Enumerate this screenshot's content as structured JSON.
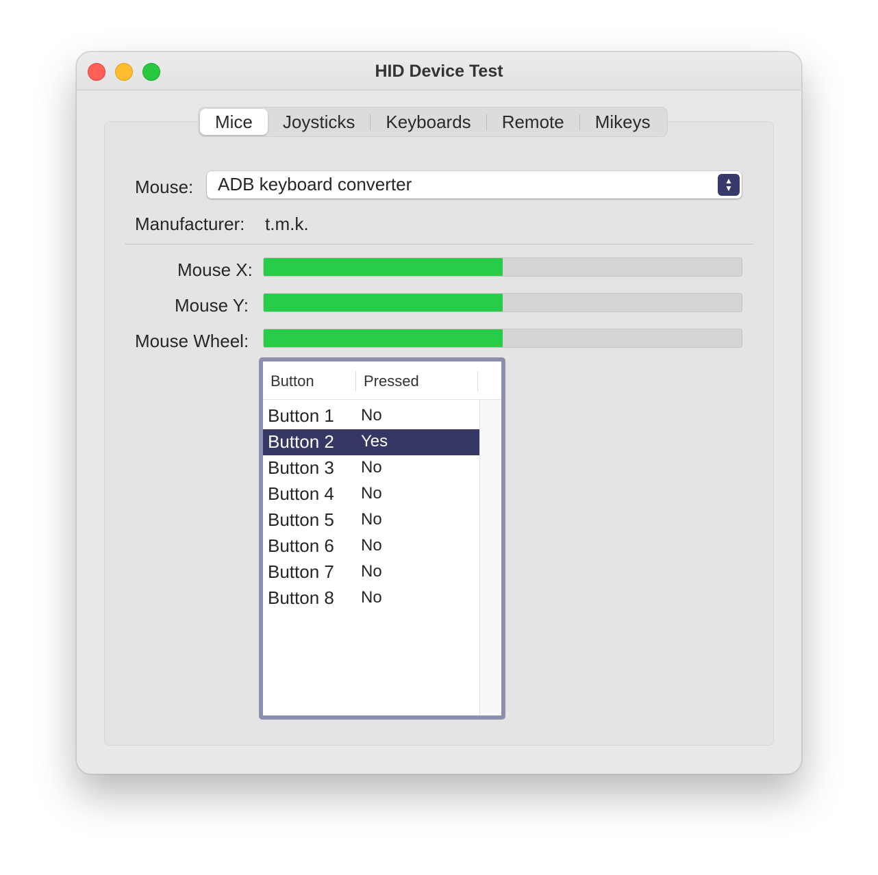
{
  "window": {
    "title": "HID Device Test"
  },
  "tabs": [
    {
      "label": "Mice",
      "active": true
    },
    {
      "label": "Joysticks",
      "active": false
    },
    {
      "label": "Keyboards",
      "active": false
    },
    {
      "label": "Remote",
      "active": false
    },
    {
      "label": "Mikeys",
      "active": false
    }
  ],
  "mouse": {
    "label": "Mouse:",
    "selected": "ADB keyboard converter",
    "manufacturer_label": "Manufacturer:",
    "manufacturer": "t.m.k."
  },
  "axes": [
    {
      "label": "Mouse X:",
      "value": 0.5
    },
    {
      "label": "Mouse Y:",
      "value": 0.5
    },
    {
      "label": "Mouse Wheel:",
      "value": 0.5
    }
  ],
  "buttons_table": {
    "columns": [
      "Button",
      "Pressed"
    ],
    "rows": [
      {
        "button": "Button 1",
        "pressed": "No",
        "selected": false
      },
      {
        "button": "Button 2",
        "pressed": "Yes",
        "selected": true
      },
      {
        "button": "Button 3",
        "pressed": "No",
        "selected": false
      },
      {
        "button": "Button 4",
        "pressed": "No",
        "selected": false
      },
      {
        "button": "Button 5",
        "pressed": "No",
        "selected": false
      },
      {
        "button": "Button 6",
        "pressed": "No",
        "selected": false
      },
      {
        "button": "Button 7",
        "pressed": "No",
        "selected": false
      },
      {
        "button": "Button 8",
        "pressed": "No",
        "selected": false
      }
    ]
  },
  "colors": {
    "accent": "#353765",
    "bar_fill": "#28cc46",
    "close": "#fe5f57",
    "minimize": "#febc2e",
    "maximize": "#28c840"
  },
  "icons": {
    "close": "close-button-icon",
    "minimize": "minimize-button-icon",
    "maximize": "zoom-button-icon",
    "popup": "up-down-chevron-icon"
  }
}
